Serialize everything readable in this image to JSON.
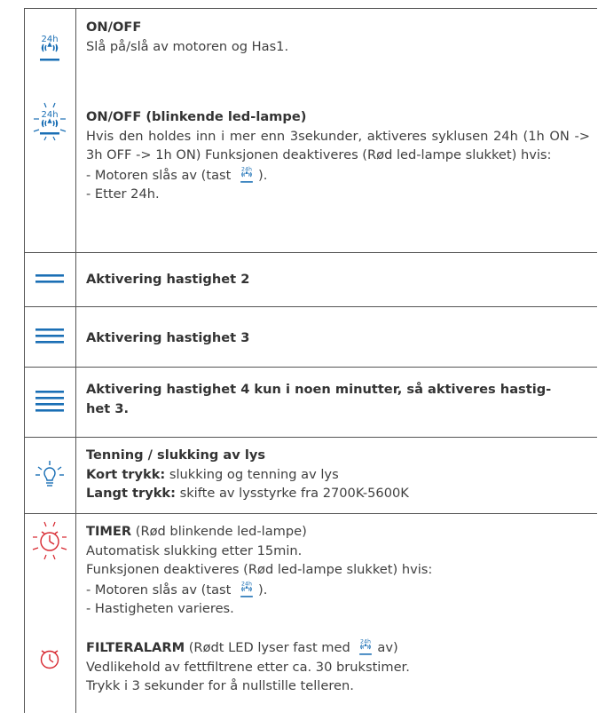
{
  "rows": [
    {
      "title": "ON/OFF",
      "lines": [
        "Slå på/slå av motoren og Has1."
      ],
      "icon": "fan-24h-icon"
    },
    {
      "title": "ON/OFF (blinkende led-lampe)",
      "paragraph": "Hvis den holdes inn i mer enn 3sekunder, aktiveres syklusen 24h (1h ON -> 3h OFF -> 1h ON) Funksjonen deaktiveres (Rød led-lampe slukket) hvis:",
      "bullet1_pre": "- Motoren slås av (tast",
      "bullet1_post": ").",
      "bullet2": "- Etter 24h.",
      "icon": "fan-24h-blinking-icon"
    },
    {
      "title": "Aktivering hastighet 2",
      "icon": "speed-2-icon"
    },
    {
      "title": "Aktivering hastighet 3",
      "icon": "speed-3-icon"
    },
    {
      "title": "Aktivering hastighet 4 kun i noen minutter, så aktiveres hastig-het 3.",
      "title_line1": "Aktivering hastighet 4 kun i noen minutter, så aktiveres hastig-",
      "title_line2": "het 3.",
      "icon": "speed-4-icon"
    },
    {
      "title": "Tenning / slukking av lys",
      "short_label": "Kort trykk:",
      "short_text": " slukking og tenning av lys",
      "long_label": "Langt trykk:",
      "long_text": " skifte av lysstyrke fra 2700K-5600K",
      "icon": "light-bulb-icon"
    },
    {
      "timer_label": "TIMER",
      "timer_suffix": " (Rød blinkende led-lampe)",
      "line1": "Automatisk slukking etter 15min.",
      "line2": "Funksjonen deaktiveres (Rød led-lampe slukket) hvis:",
      "bullet1_pre": "- Motoren slås av (tast",
      "bullet1_post": ").",
      "bullet2": "- Hastigheten varieres.",
      "filter_label": "FILTERALARM",
      "filter_suffix_pre": " (Rødt LED lyser fast med",
      "filter_suffix_post": "av)",
      "filter_line1": "Vedlikehold av fettfiltrene etter ca. 30 brukstimer.",
      "filter_line2": "Trykk i 3 sekunder for å nullstille telleren.",
      "timer_icon": "timer-blinking-icon",
      "filter_icon": "filter-alarm-clock-icon"
    }
  ],
  "icon_text": {
    "h24": "24h"
  },
  "colors": {
    "icon_blue": "#1a6fb5",
    "alarm_red": "#d7262e",
    "border": "#555555",
    "text": "#404040"
  }
}
